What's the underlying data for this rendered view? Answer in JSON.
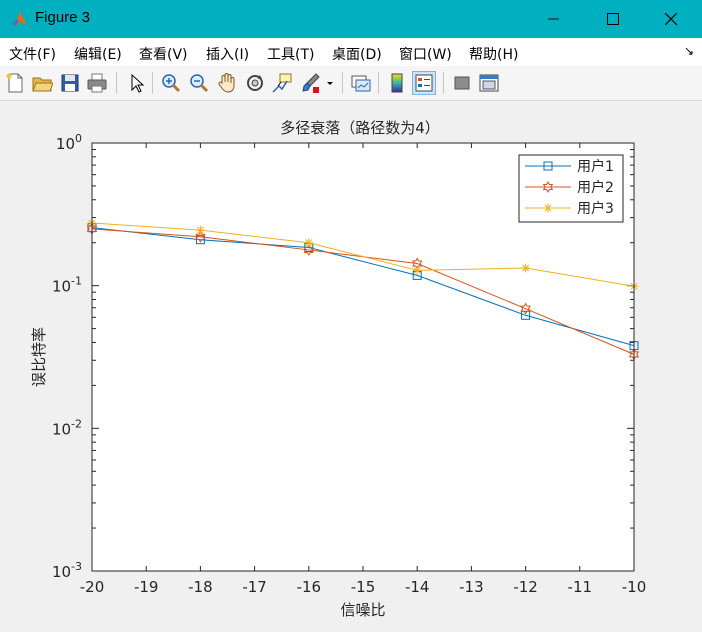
{
  "window": {
    "title": "Figure 3"
  },
  "menu": [
    {
      "label": "文件(F)"
    },
    {
      "label": "编辑(E)"
    },
    {
      "label": "查看(V)"
    },
    {
      "label": "插入(I)"
    },
    {
      "label": "工具(T)"
    },
    {
      "label": "桌面(D)"
    },
    {
      "label": "窗口(W)"
    },
    {
      "label": "帮助(H)"
    }
  ],
  "toolbar": {
    "icons": [
      "new-figure-icon",
      "open-file-icon",
      "save-icon",
      "print-icon",
      "pointer-icon",
      "zoom-in-icon",
      "zoom-out-icon",
      "pan-hand-icon",
      "rotate-3d-icon",
      "data-cursor-icon",
      "brush-icon",
      "brush-dropdown-icon",
      "link-plot-icon",
      "colorbar-icon",
      "legend-icon",
      "hide-plot-tools-icon",
      "show-plot-tools-icon"
    ]
  },
  "chart_data": {
    "type": "line",
    "title": "多径衰落（路径数为4）",
    "xlabel": "信噪比",
    "ylabel": "误比特率",
    "x": [
      -20,
      -18,
      -16,
      -14,
      -12,
      -10
    ],
    "xlim": [
      -20,
      -10
    ],
    "xticks": [
      "-20",
      "-19",
      "-18",
      "-17",
      "-16",
      "-15",
      "-14",
      "-13",
      "-12",
      "-11",
      "-10"
    ],
    "yscale": "log",
    "ylim": [
      0.001,
      1
    ],
    "yticks": [
      {
        "base": "10",
        "exp": "0"
      },
      {
        "base": "10",
        "exp": "-1"
      },
      {
        "base": "10",
        "exp": "-2"
      },
      {
        "base": "10",
        "exp": "-3"
      }
    ],
    "legend_position": "top-right",
    "grid": false,
    "series": [
      {
        "name": "用户1",
        "color": "#0072bd",
        "marker": "square",
        "values": [
          0.255,
          0.21,
          0.185,
          0.118,
          0.062,
          0.038
        ]
      },
      {
        "name": "用户2",
        "color": "#d95319",
        "marker": "hexagram",
        "values": [
          0.25,
          0.22,
          0.178,
          0.143,
          0.069,
          0.033
        ]
      },
      {
        "name": "用户3",
        "color": "#edb120",
        "marker": "asterisk",
        "values": [
          0.275,
          0.245,
          0.2,
          0.128,
          0.133,
          0.099
        ]
      }
    ]
  }
}
